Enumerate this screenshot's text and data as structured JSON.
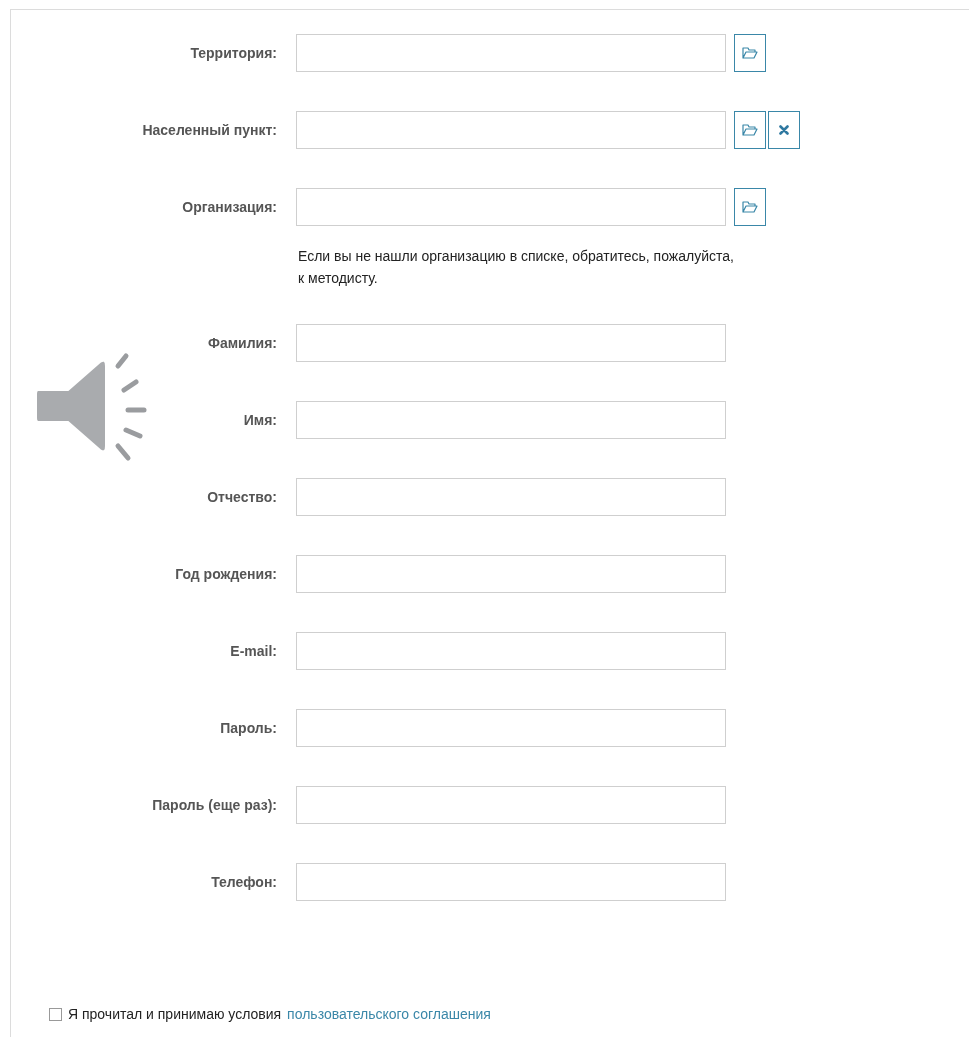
{
  "fields": [
    {
      "label": "Территория:",
      "buttons": [
        {
          "kind": "browse"
        }
      ]
    },
    {
      "label": "Населенный пункт:",
      "buttons": [
        {
          "kind": "browse"
        },
        {
          "kind": "clear"
        }
      ]
    },
    {
      "label": "Организация:",
      "buttons": [
        {
          "kind": "browse"
        }
      ]
    },
    {
      "kind": "note",
      "text": "Если вы не нашли организацию в списке, обратитесь, пожалуйста, к методисту."
    },
    {
      "label": "Фамилия:"
    },
    {
      "label": "Имя:"
    },
    {
      "label": "Отчество:"
    },
    {
      "label": "Год рождения:"
    },
    {
      "label": "E-mail:"
    },
    {
      "label": "Пароль:"
    },
    {
      "label": "Пароль (еще раз):"
    },
    {
      "label": "Телефон:"
    }
  ],
  "agreement": {
    "checked": false,
    "text": "Я прочитал и принимаю условия",
    "link": "пользовательского соглашения"
  }
}
